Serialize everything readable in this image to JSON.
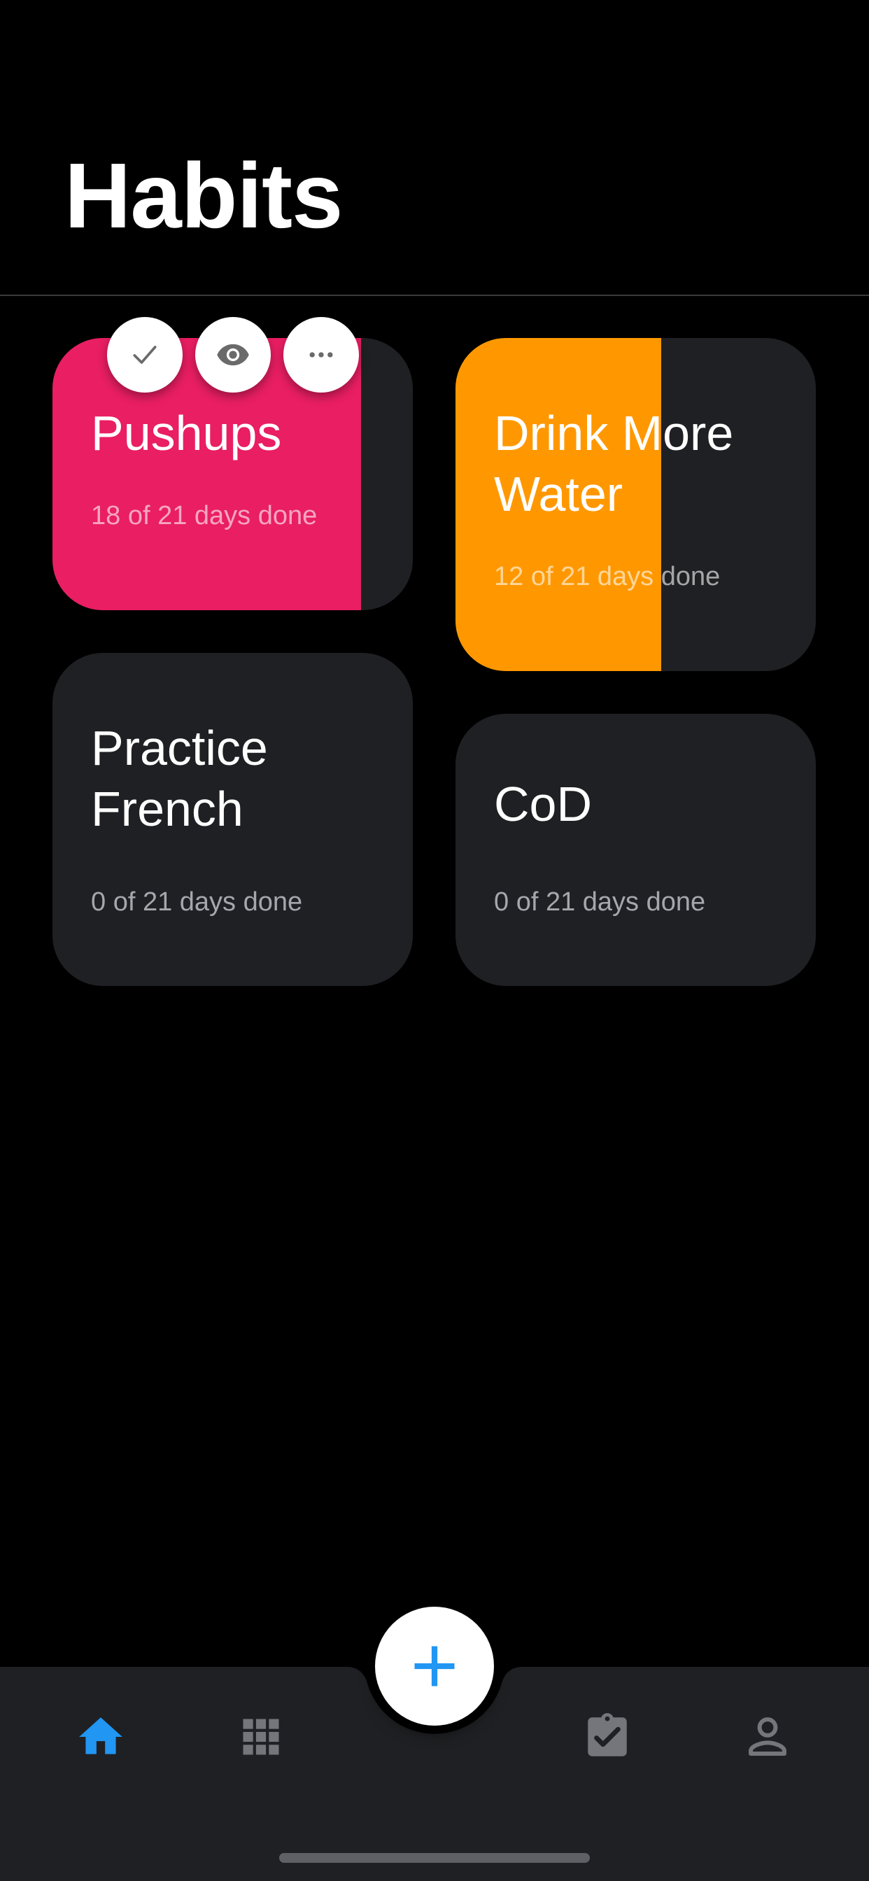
{
  "header": {
    "title": "Habits"
  },
  "habits": [
    {
      "name": "Pushups",
      "progress_text": "18 of 21 days done",
      "days_done": 18,
      "days_total": 21,
      "color": "#e91e63"
    },
    {
      "name": "Drink More Water",
      "name_lines": [
        "Drink More",
        "Water"
      ],
      "progress_text": "12 of 21 days done",
      "days_done": 12,
      "days_total": 21,
      "color": "#ff9800"
    },
    {
      "name": "Practice French",
      "name_lines": [
        "Practice",
        "French"
      ],
      "progress_text": "0 of 21 days done",
      "days_done": 0,
      "days_total": 21,
      "color": "#1f2023"
    },
    {
      "name": "CoD",
      "progress_text": "0 of 21 days done",
      "days_done": 0,
      "days_total": 21,
      "color": "#1f2023"
    }
  ],
  "quick_actions": [
    {
      "icon": "check-icon"
    },
    {
      "icon": "eye-icon"
    },
    {
      "icon": "more-horizontal-icon"
    }
  ],
  "bottom_nav": {
    "items": [
      {
        "icon": "home-icon",
        "active": true
      },
      {
        "icon": "apps-grid-icon",
        "active": false
      },
      {
        "icon": "add-icon",
        "active": false
      },
      {
        "icon": "clipboard-check-icon",
        "active": false
      },
      {
        "icon": "person-icon",
        "active": false
      }
    ]
  },
  "colors": {
    "background": "#000000",
    "card": "#1f2023",
    "accent": "#2196f3",
    "pushups": "#e91e63",
    "water": "#ff9800",
    "nav_inactive": "#74767b"
  }
}
